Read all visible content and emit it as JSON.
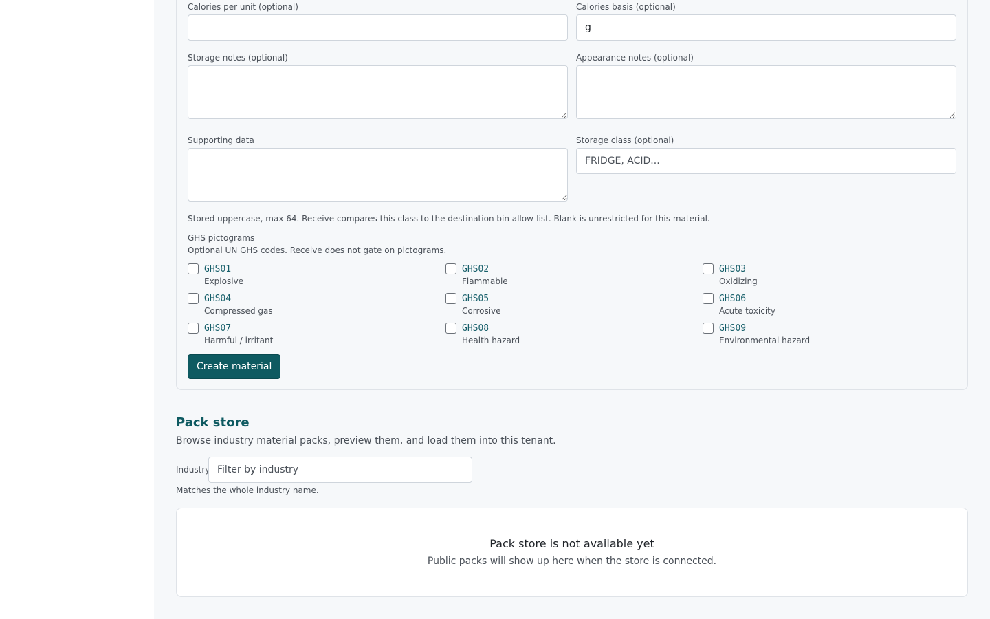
{
  "form": {
    "calories_per_unit": {
      "label": "Calories per unit (optional)",
      "value": ""
    },
    "calories_basis": {
      "label": "Calories basis (optional)",
      "value": "g"
    },
    "storage_notes": {
      "label": "Storage notes (optional)",
      "value": ""
    },
    "appearance_notes": {
      "label": "Appearance notes (optional)",
      "value": ""
    },
    "supporting_data": {
      "label": "Supporting data",
      "value": ""
    },
    "storage_class": {
      "label": "Storage class (optional)",
      "placeholder": "FRIDGE, ACID..."
    },
    "storage_class_hint": "Stored uppercase, max 64. Receive compares this class to the destination bin allow-list. Blank is unrestricted for this material.",
    "ghs": {
      "title": "GHS pictograms",
      "hint": "Optional UN GHS codes. Receive does not gate on pictograms.",
      "items": [
        {
          "code": "GHS01",
          "desc": "Explosive",
          "checked": false
        },
        {
          "code": "GHS02",
          "desc": "Flammable",
          "checked": false
        },
        {
          "code": "GHS03",
          "desc": "Oxidizing",
          "checked": false
        },
        {
          "code": "GHS04",
          "desc": "Compressed gas",
          "checked": false
        },
        {
          "code": "GHS05",
          "desc": "Corrosive",
          "checked": false
        },
        {
          "code": "GHS06",
          "desc": "Acute toxicity",
          "checked": false
        },
        {
          "code": "GHS07",
          "desc": "Harmful / irritant",
          "checked": false
        },
        {
          "code": "GHS08",
          "desc": "Health hazard",
          "checked": false
        },
        {
          "code": "GHS09",
          "desc": "Environmental hazard",
          "checked": false
        }
      ]
    },
    "submit_label": "Create material"
  },
  "pack_store": {
    "title": "Pack store",
    "subtitle": "Browse industry material packs, preview them, and load them into this tenant.",
    "industry_label": "Industry",
    "industry_placeholder": "Filter by industry",
    "industry_hint": "Matches the whole industry name.",
    "empty_title": "Pack store is not available yet",
    "empty_subtitle": "Public packs will show up here when the store is connected."
  },
  "colors": {
    "accent": "#0e5a61",
    "code": "#175f6a",
    "background": "#f6f8fa"
  }
}
